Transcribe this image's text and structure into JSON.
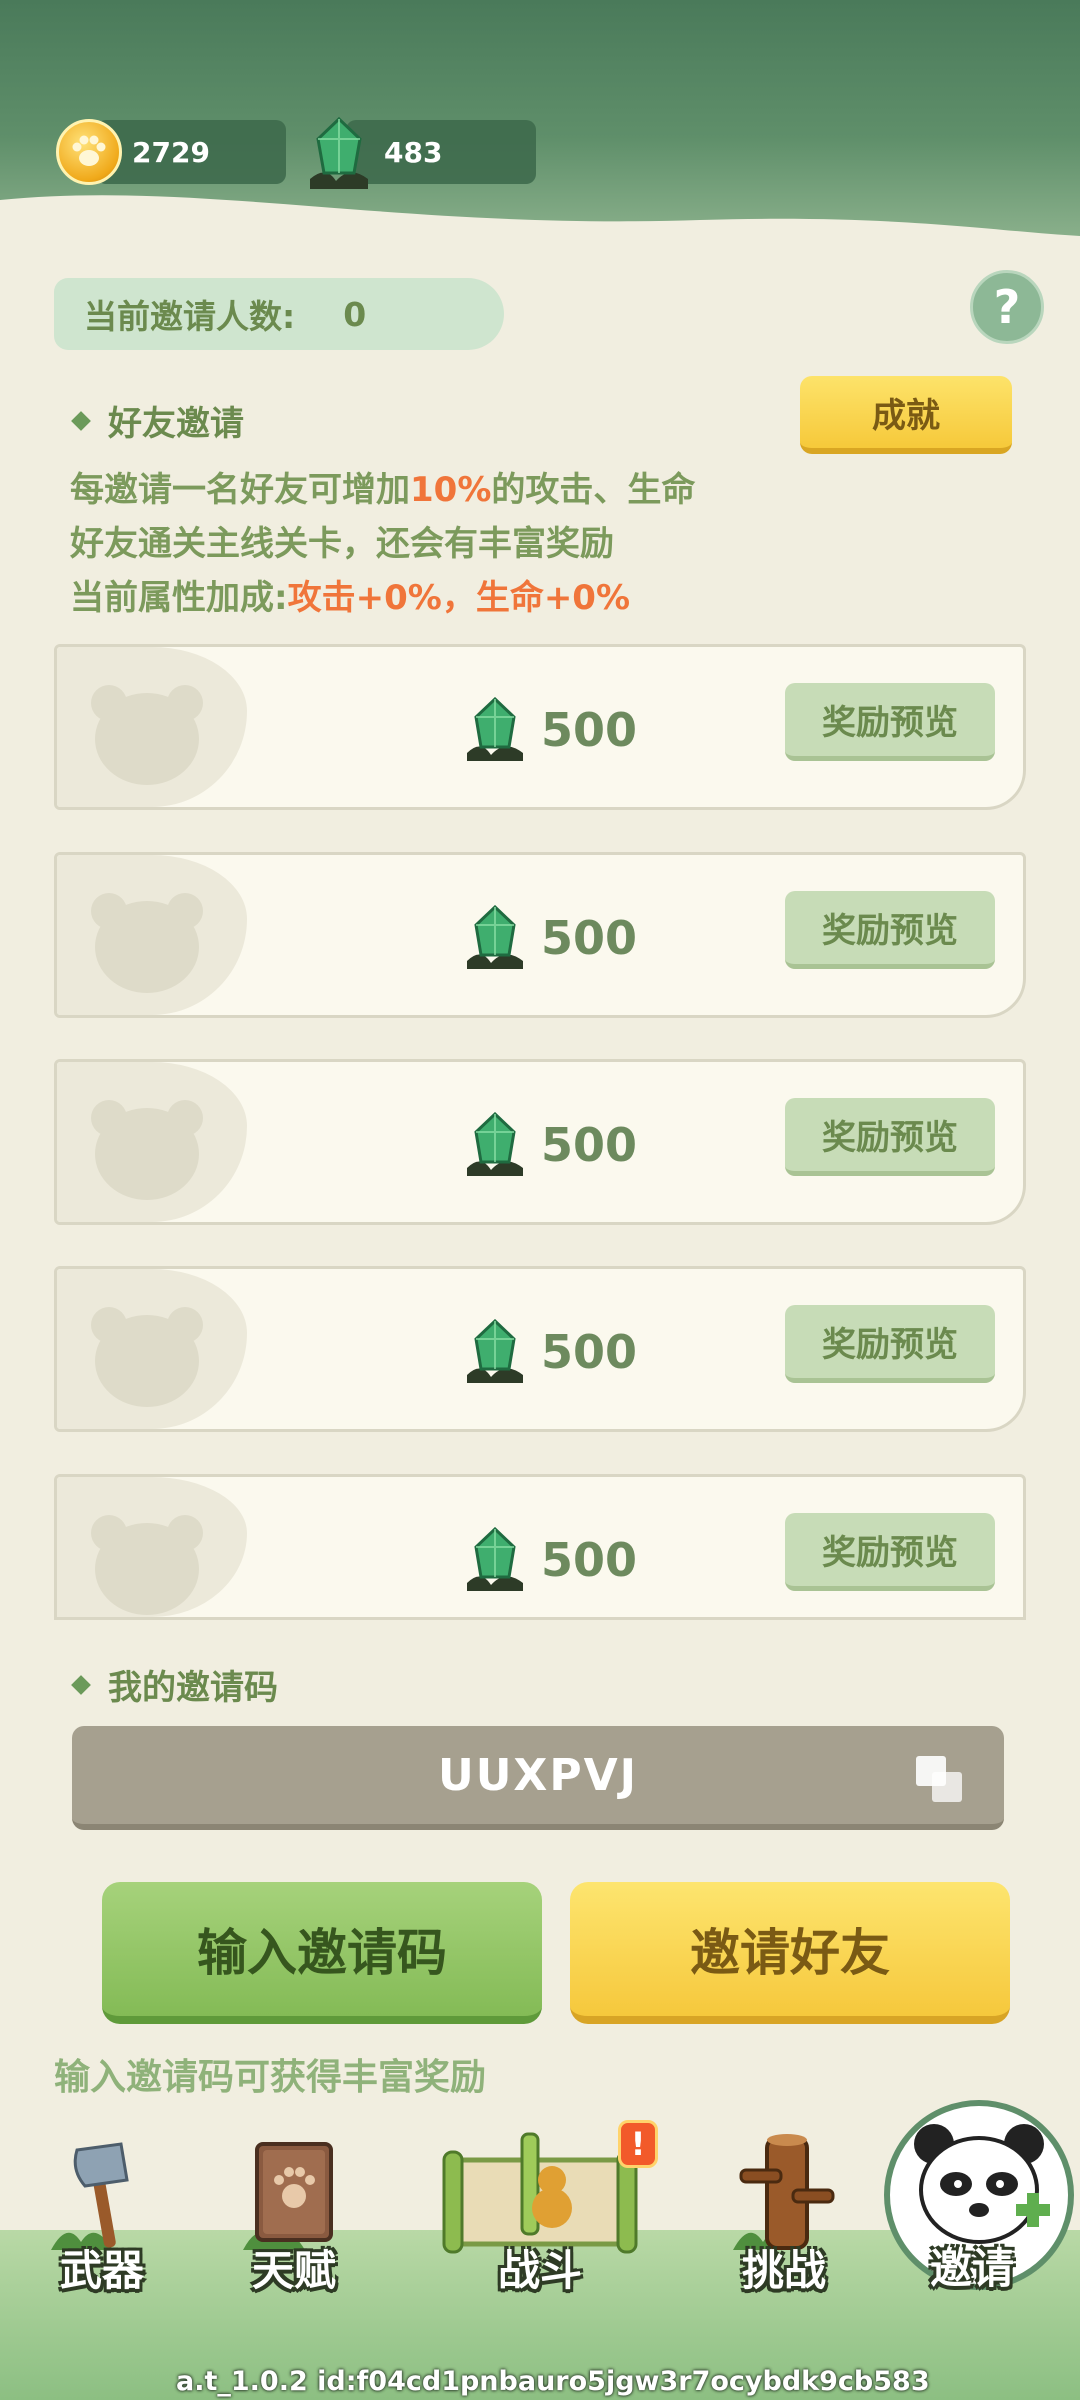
{
  "header": {
    "paw_coins": "2729",
    "gems": "483"
  },
  "invite_count": {
    "label": "当前邀请人数:",
    "value": "0"
  },
  "help_label": "?",
  "friend_invite": {
    "title": "好友邀请",
    "achievement_button": "成就",
    "line1_a": "每邀请一名好友可增加",
    "line1_pct": "10%",
    "line1_b": "的攻击、生命",
    "line2": "好友通关主线关卡，还会有丰富奖励",
    "line3_a": "当前属性加成:",
    "line3_b": "攻击+0%，生命+0%"
  },
  "rewards": [
    {
      "amount": "500",
      "button": "奖励预览"
    },
    {
      "amount": "500",
      "button": "奖励预览"
    },
    {
      "amount": "500",
      "button": "奖励预览"
    },
    {
      "amount": "500",
      "button": "奖励预览"
    },
    {
      "amount": "500",
      "button": "奖励预览"
    }
  ],
  "my_code": {
    "title": "我的邀请码",
    "code": "UUXPVJ"
  },
  "buttons": {
    "enter_code": "输入邀请码",
    "invite_friends": "邀请好友"
  },
  "hint": "输入邀请码可获得丰富奖励",
  "nav": {
    "weapon": "武器",
    "talent": "天赋",
    "battle": "战斗",
    "battle_badge": "!",
    "challenge": "挑战",
    "invite": "邀请"
  },
  "footer": "a.t_1.0.2 id:f04cd1pnbauro5jgw3r7ocybdk9cb583",
  "colors": {
    "accent_green": "#6b8a4e",
    "highlight_orange": "#f0753a",
    "button_yellow": "#f6c93a",
    "button_green": "#84bb56"
  }
}
